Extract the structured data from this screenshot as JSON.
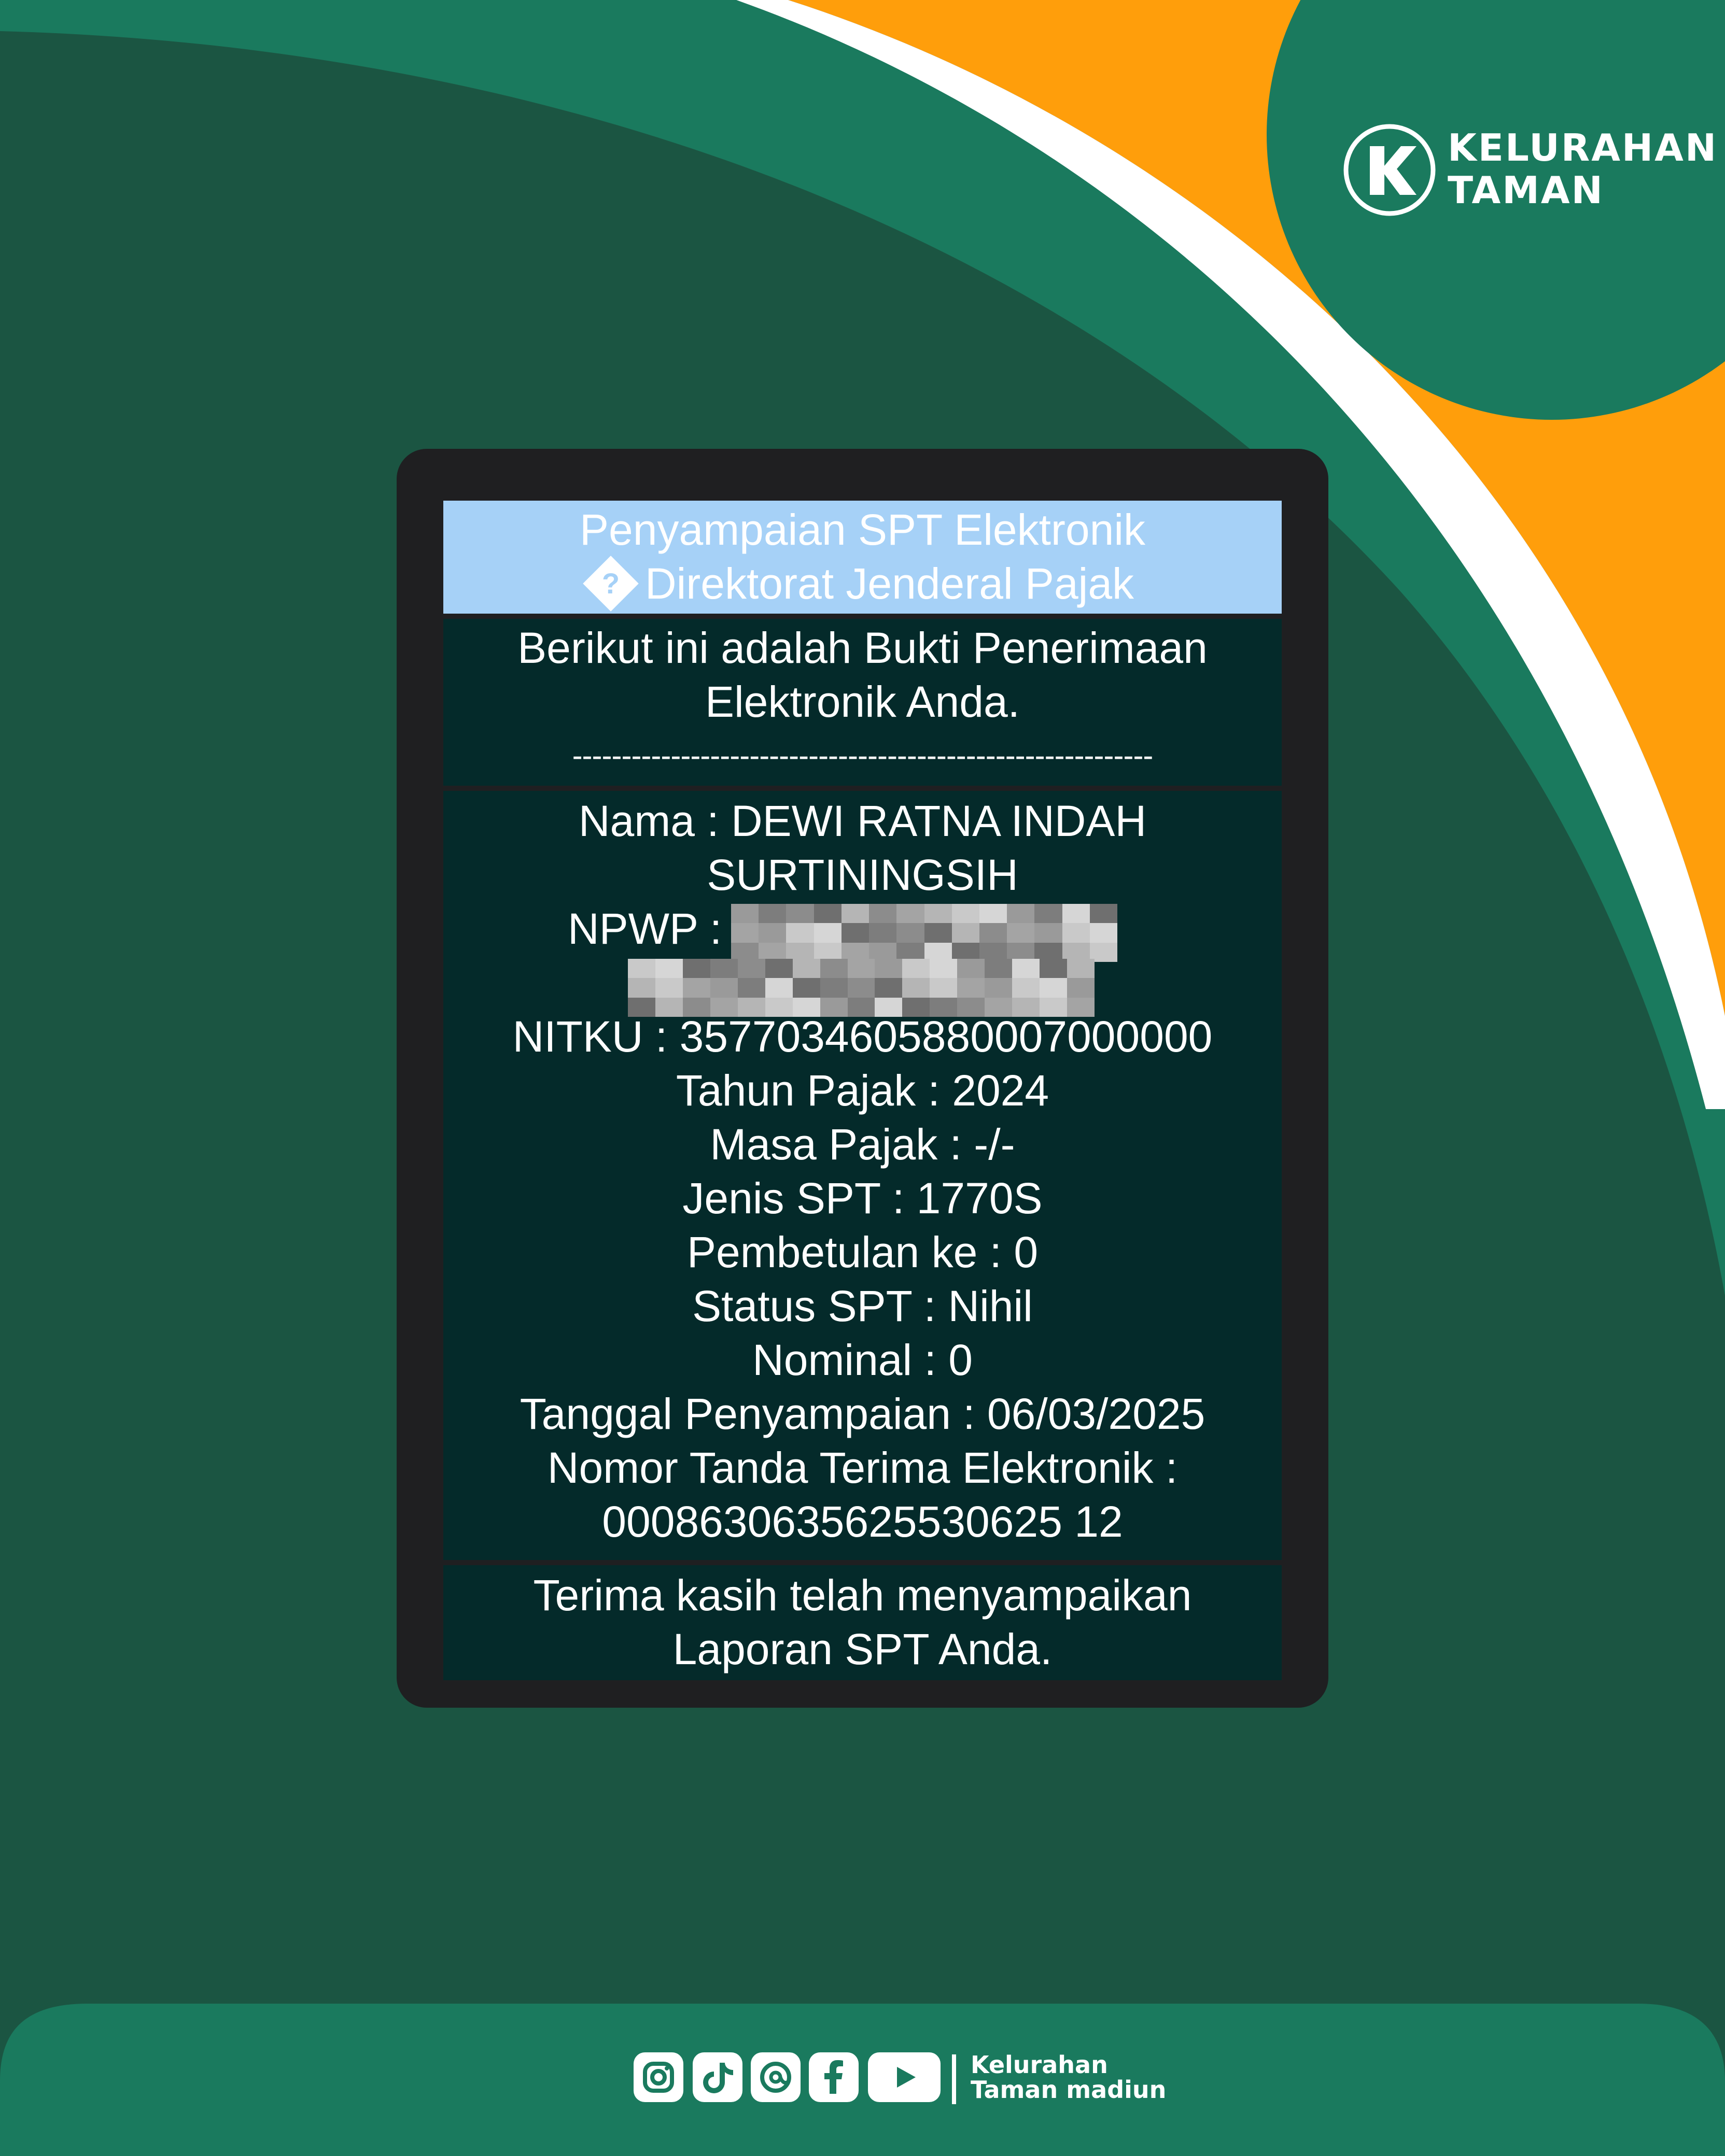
{
  "colors": {
    "dark_green": "#1b5542",
    "mid_green": "#1a7a5e",
    "orange": "#ff9e0b",
    "white": "#ffffff",
    "card_dark": "#1f1f21",
    "screen_header": "#a6d1f7",
    "screen_block": "#042a2a"
  },
  "brand": {
    "name_line1": "KELURAHAN",
    "name_line2": "TAMAN",
    "logo_icon": "k-logo-icon"
  },
  "receipt": {
    "header_line1": "Penyampaian SPT Elektronik",
    "header_line2": "Direktorat Jenderal Pajak",
    "intro_line1": "Berikut ini adalah Bukti Penerimaan",
    "intro_line2": "Elektronik Anda.",
    "divider": "-----------------------------------------------------------",
    "nama_line1": "Nama : DEWI RATNA INDAH",
    "nama_line2": "SURTININGSIH",
    "npwp_label": "NPWP : ",
    "npwp_value": "(blurred)",
    "nitku": "NITKU : 3577034605880007000000",
    "tahun_pajak": "Tahun Pajak : 2024",
    "masa_pajak": "Masa Pajak : -/-",
    "jenis_spt": "Jenis SPT : 1770S",
    "pembetulan": "Pembetulan ke : 0",
    "status_spt": "Status SPT : Nihil",
    "nominal": "Nominal : 0",
    "tanggal": "Tanggal Penyampaian : 06/03/2025",
    "nomor_label": "Nomor Tanda Terima Elektronik :",
    "nomor_value": "0008630635625530625 12",
    "thanks_line1": "Terima kasih telah menyampaikan",
    "thanks_line2": "Laporan SPT Anda."
  },
  "footer": {
    "icons": [
      "instagram-icon",
      "tiktok-icon",
      "threads-icon",
      "facebook-icon",
      "youtube-icon"
    ],
    "text_line1": "Kelurahan",
    "text_line2": "Taman madiun"
  }
}
